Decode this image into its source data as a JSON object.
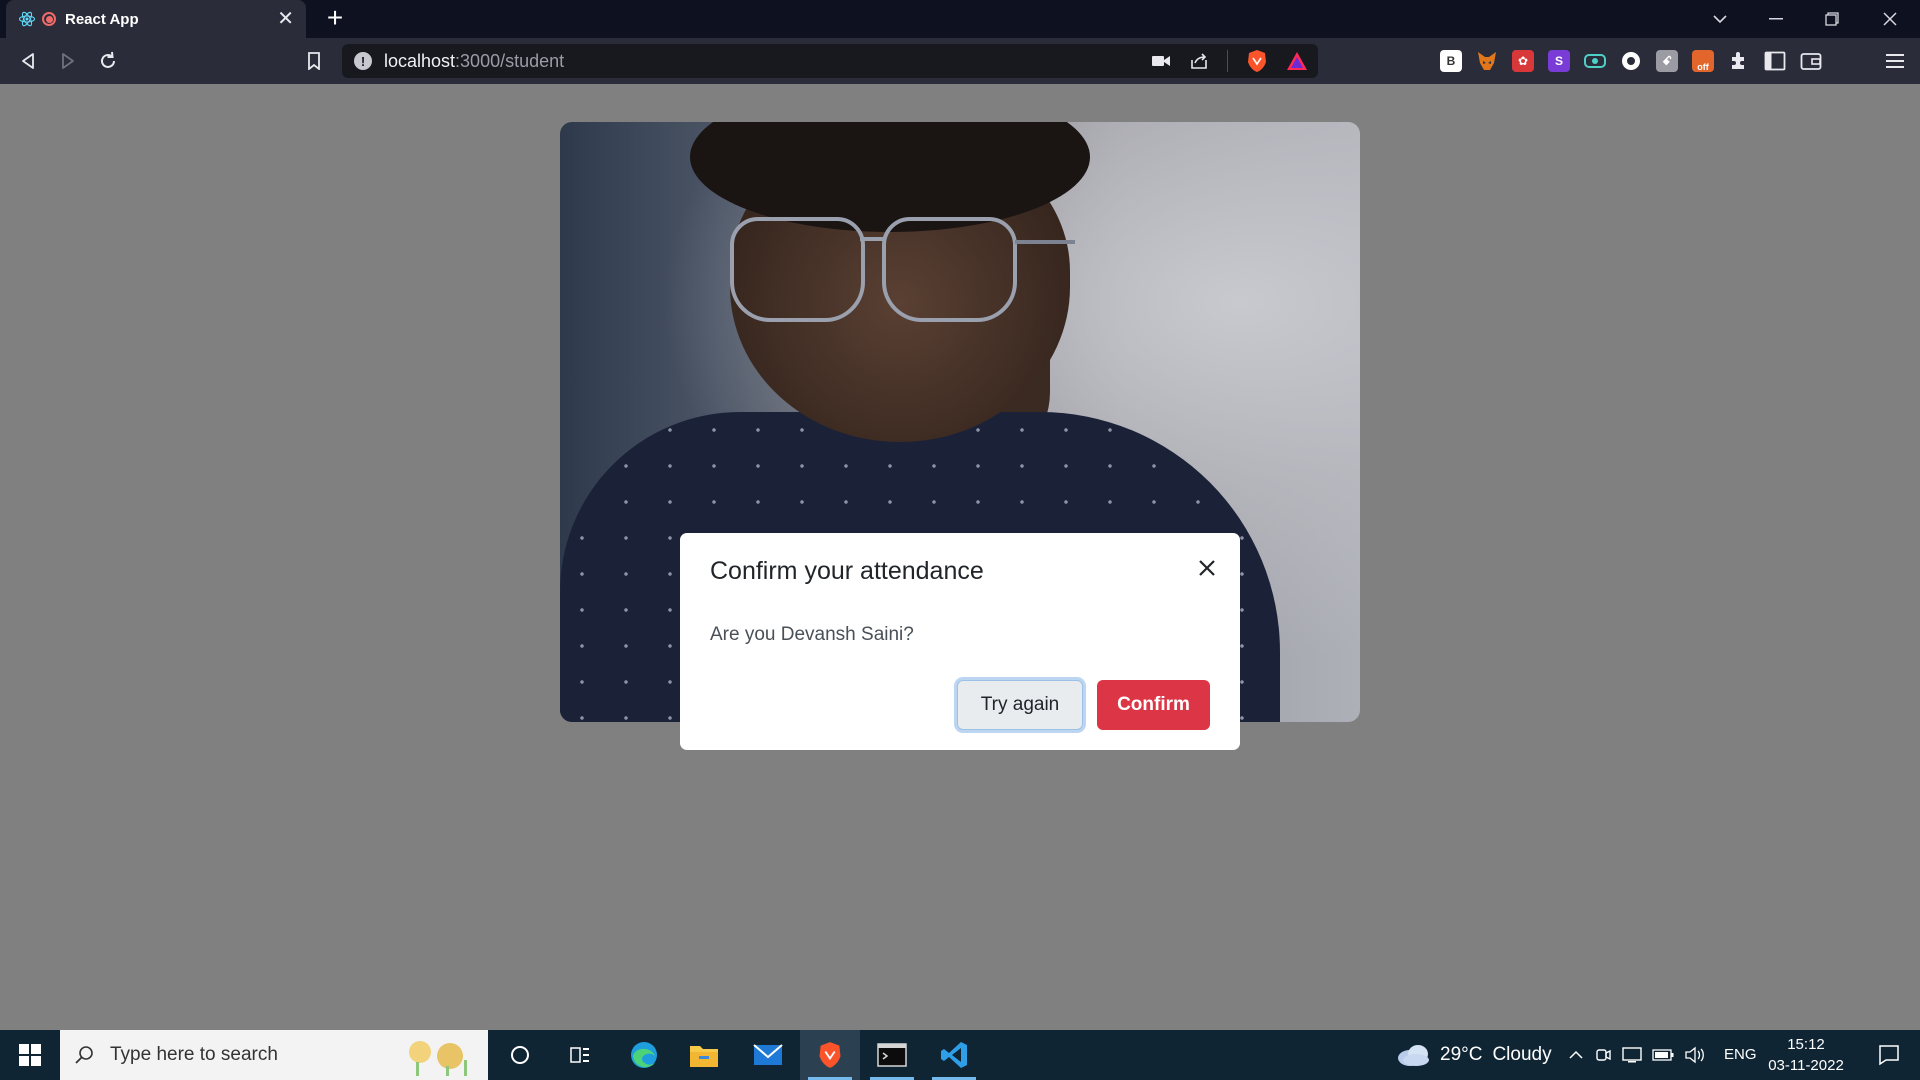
{
  "browser": {
    "tab_title": "React App",
    "url_host": "localhost",
    "url_path": ":3000/student",
    "extensions": [
      {
        "name": "b-extension-icon",
        "glyph": "B",
        "color": "#ffffff",
        "text": "#333333"
      },
      {
        "name": "metamask-fox-icon",
        "glyph": "🦊",
        "color": "#2a2d39",
        "text": "#ffffff"
      },
      {
        "name": "red-extension-icon",
        "glyph": "✿",
        "color": "#d9383a",
        "text": "#ffffff"
      },
      {
        "name": "s-extension-icon",
        "glyph": "S",
        "color": "#7a3cd6",
        "text": "#ffffff"
      },
      {
        "name": "teal-extension-icon",
        "glyph": "▭",
        "color": "#2a2d39",
        "text": "#4fd0c7"
      },
      {
        "name": "white-circle-extension-icon",
        "glyph": "●",
        "color": "#2a2d39",
        "text": "#ffffff"
      },
      {
        "name": "grey-extension-icon",
        "glyph": "⚲",
        "color": "#9b9ba3",
        "text": "#ffffff"
      },
      {
        "name": "off-extension-icon",
        "glyph": "off",
        "color": "#e2652b",
        "text": "#ffffff"
      }
    ]
  },
  "modal": {
    "title": "Confirm your attendance",
    "body": "Are you Devansh Saini?",
    "try_again_label": "Try again",
    "confirm_label": "Confirm"
  },
  "taskbar": {
    "search_placeholder": "Type here to search",
    "weather_temp": "29°C",
    "weather_desc": "Cloudy",
    "language": "ENG",
    "time": "15:12",
    "date": "03-11-2022"
  },
  "colors": {
    "confirm": "#dc3545",
    "overlay": "#808080",
    "taskbar": "#0f2534"
  }
}
